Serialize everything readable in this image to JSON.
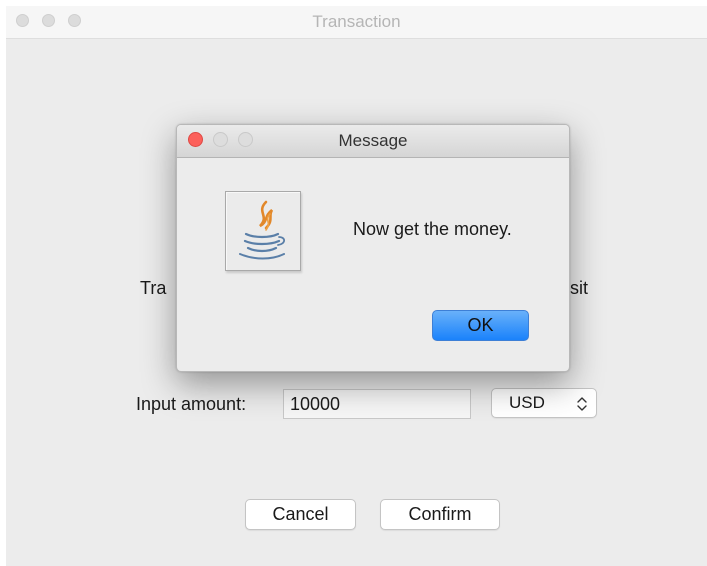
{
  "window": {
    "title": "Transaction"
  },
  "form": {
    "transaction_type_label_partial": "Tra",
    "deposit_label_partial": "osit",
    "amount_label": "Input amount:",
    "amount_value": "10000",
    "currency_selected": "USD",
    "cancel_label": "Cancel",
    "confirm_label": "Confirm"
  },
  "dialog": {
    "title": "Message",
    "icon": "java-coffee-cup-icon",
    "message": "Now get the money.",
    "ok_label": "OK"
  },
  "colors": {
    "dialog_close_button": "#fc605b",
    "ok_button_accent": "#1a82fb"
  }
}
